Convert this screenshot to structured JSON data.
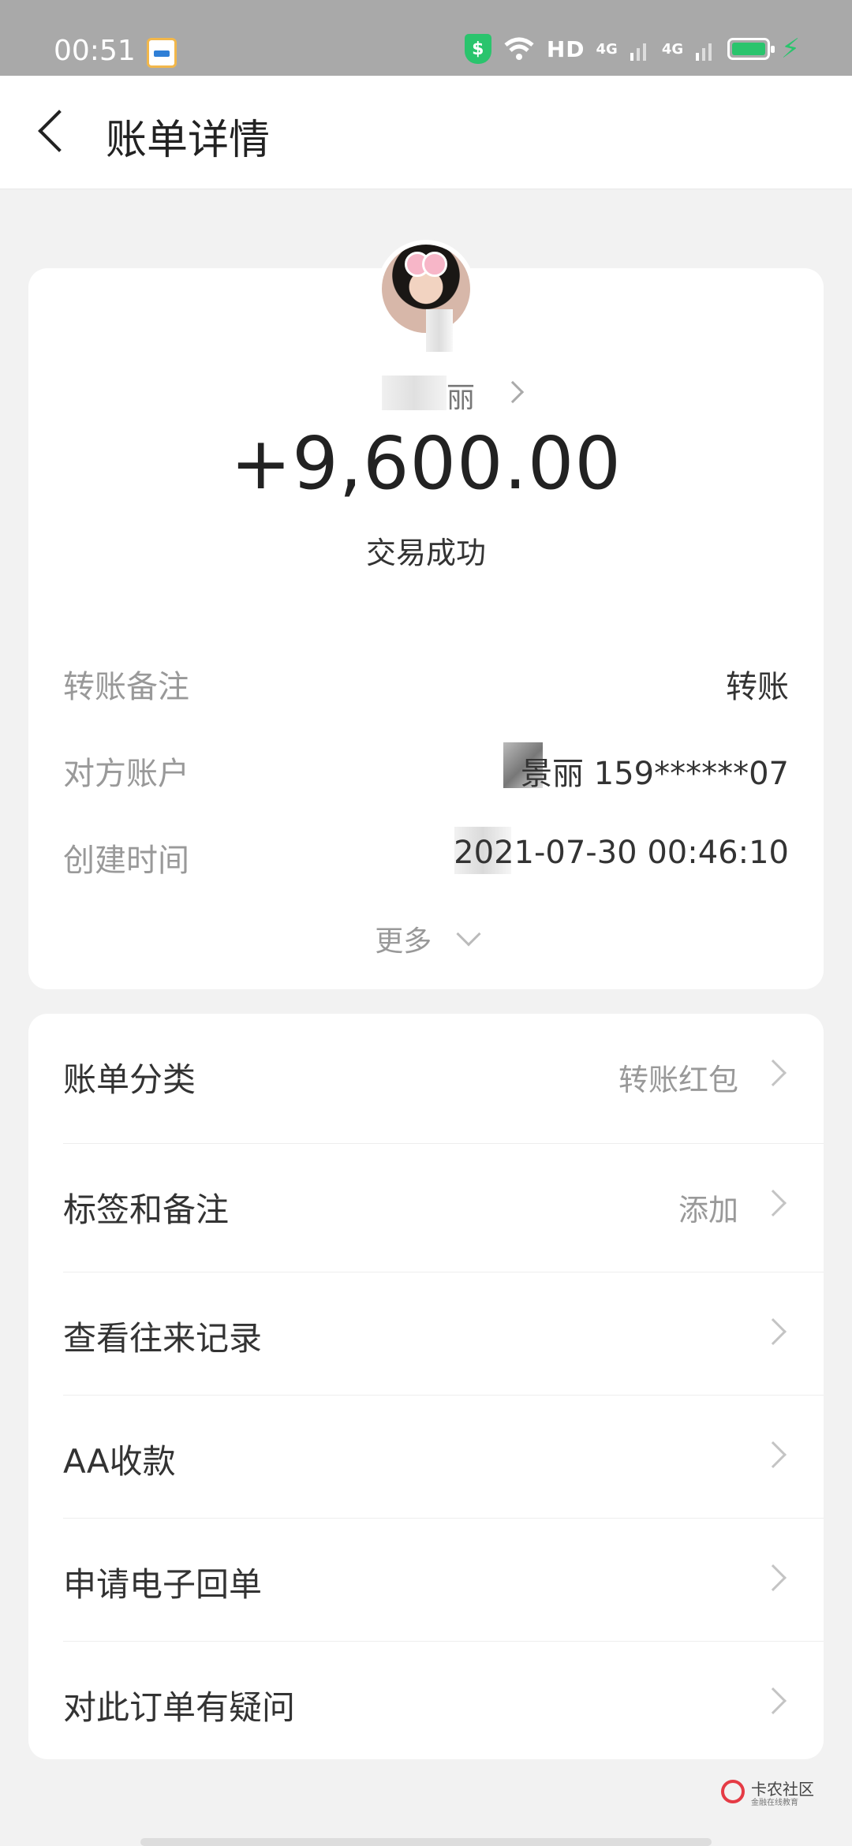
{
  "status_bar": {
    "time": "00:51",
    "network_text": "HD",
    "signal_1": "4G",
    "signal_2": "4G",
    "colors": {
      "background": "#a9a9a9",
      "battery": "#2ac46d"
    },
    "icons": [
      "app-badge-icon",
      "shield-dollar-icon",
      "wifi-icon",
      "signal-icon",
      "battery-icon",
      "charging-icon"
    ]
  },
  "header": {
    "title": "账单详情",
    "back_icon": "chevron-left-icon"
  },
  "transaction": {
    "payee_name": "丽",
    "amount": "+9,600.00",
    "status": "交易成功",
    "details": [
      {
        "label": "转账备注",
        "value": "转账"
      },
      {
        "label": "对方账户",
        "value": "景丽 159******07"
      },
      {
        "label": "创建时间",
        "value": "2021-07-30 00:46:10"
      }
    ],
    "more_label": "更多"
  },
  "actions": [
    {
      "label": "账单分类",
      "value": "转账红包"
    },
    {
      "label": "标签和备注",
      "value": "添加"
    },
    {
      "label": "查看往来记录",
      "value": ""
    },
    {
      "label": "AA收款",
      "value": ""
    },
    {
      "label": "申请电子回单",
      "value": ""
    },
    {
      "label": "对此订单有疑问",
      "value": ""
    }
  ],
  "watermark": {
    "title": "卡农社区",
    "subtitle": "金融在线教育"
  }
}
